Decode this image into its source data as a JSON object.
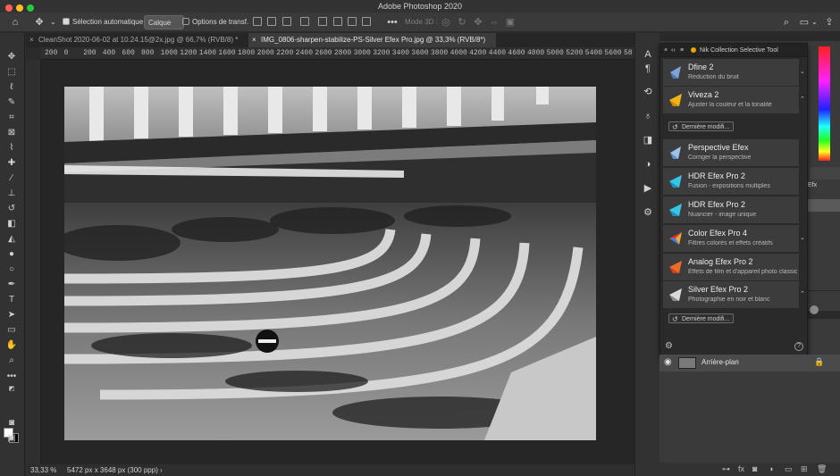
{
  "app": {
    "title": "Adobe Photoshop 2020"
  },
  "colors": {
    "close": "#ff5f57",
    "minimize": "#febc2e",
    "maximize": "#28c840"
  },
  "options_bar": {
    "auto_select_label": "Sélection automatique :",
    "auto_select_target": "Calque",
    "transform_controls_label": "Options de transf.",
    "mode_3d_label": "Mode 3D :"
  },
  "tabs": [
    {
      "label": "CleanShot 2020-06-02 at 10.24.15@2x.jpg @ 66,7% (RVB/8) *"
    },
    {
      "label": "IMG_0806-sharpen-stabilize-PS-Silver Efex Pro.jpg @ 33,3% (RVB/8*)"
    }
  ],
  "ruler": {
    "ticks": [
      "200",
      "0",
      "200",
      "400",
      "600",
      "800",
      "1000",
      "1200",
      "1400",
      "1600",
      "1800",
      "2000",
      "2200",
      "2400",
      "2600",
      "2800",
      "3000",
      "3200",
      "3400",
      "3600",
      "3800",
      "4000",
      "4200",
      "4400",
      "4600",
      "4800",
      "5000",
      "5200",
      "5400",
      "5600",
      "58"
    ]
  },
  "status": {
    "zoom": "33,33 %",
    "doc_size": "5472 px x 3648 px (300 ppp)",
    "arrow": "›"
  },
  "nik": {
    "title": "Nik Collection Selective Tool",
    "history_label": "Dernière modifi...",
    "items": [
      {
        "name": "Dfine 2",
        "desc": "Réduction du bruit"
      },
      {
        "name": "Viveza 2",
        "desc": "Ajuster la couleur et la tonalité"
      },
      {
        "name": "Perspective Efex",
        "desc": "Corriger la perspective"
      },
      {
        "name": "HDR Efex Pro 2",
        "desc": "Fusion - expositions multiples"
      },
      {
        "name": "HDR Efex Pro 2",
        "desc": "Nuancier - image unique"
      },
      {
        "name": "Color Efex Pro 4",
        "desc": "Filtres colorés et effets créatifs"
      },
      {
        "name": "Analog Efex Pro 2",
        "desc": "Effets de film et d'appareil photo classiques"
      },
      {
        "name": "Silver Efex Pro 2",
        "desc": "Photographie en noir et blanc"
      }
    ]
  },
  "panels": {
    "truncated_label": "Efx"
  },
  "layers": [
    {
      "name": "Arrière-plan"
    }
  ],
  "icons": {
    "home": "home-icon",
    "move": "move-icon",
    "search": "search-icon",
    "workspace": "workspace-icon",
    "share": "share-icon",
    "eye": "eye-icon",
    "lock": "lock-icon",
    "gear": "gear-icon",
    "help": "help-icon"
  }
}
